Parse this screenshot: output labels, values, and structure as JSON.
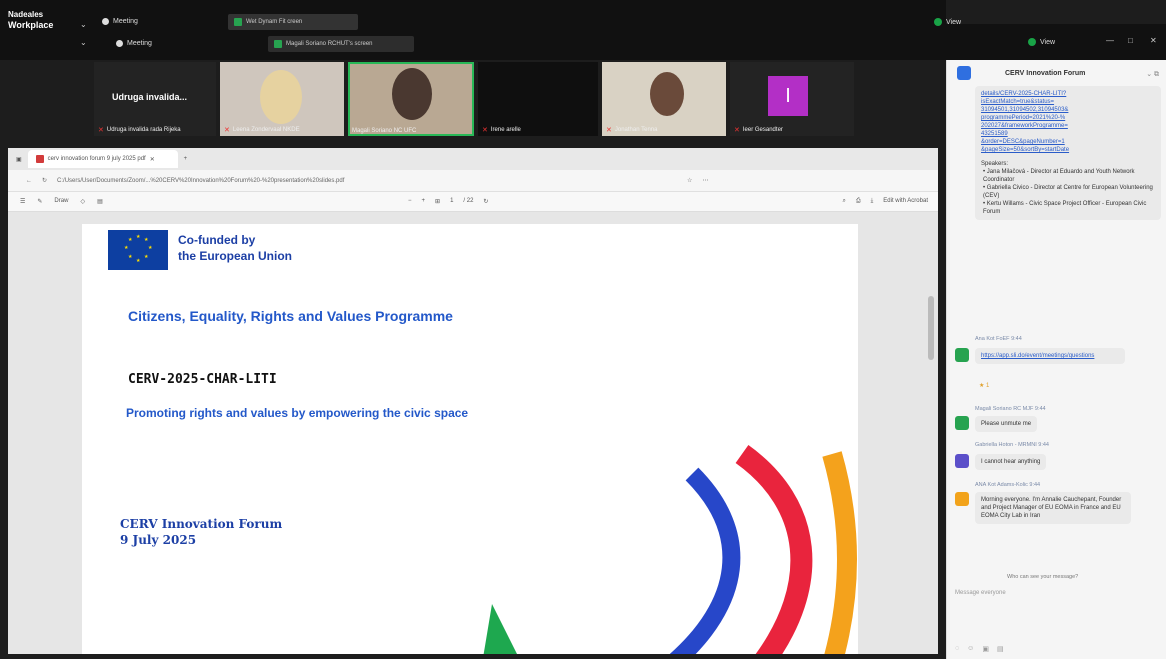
{
  "topbar": {
    "workspace_small": "Nadeales",
    "workspace_big": "Workplace",
    "item1": "Meeting",
    "item2": "Meeting",
    "tab1": "Wet Dynam Fit creen",
    "tab2": "Magali Soriano RCHUT's screen",
    "view_label": "View"
  },
  "gallery": {
    "tile1_big": "Udruga invalida...",
    "tile1_name": "Udruga invalida rada Rijeka",
    "tile2_name": "Leena Zondervaal NKDE",
    "tile3_name": "Magali Soriano NC UFC",
    "tile4_name": "Irene arelle",
    "tile5_name": "Jonathan Tenna",
    "tile6_name": "Ieer Gesandter",
    "tile6_initial": "I"
  },
  "browser": {
    "tab_label": "cerv innovation forum 9 july 2025 pdf",
    "url": "C:/Users/User/Documents/Zoom/...%20CERV%20Innovation%20Forum%20-%20presentation%20slides.pdf",
    "zoom": "118",
    "page_current": "1",
    "page_total": "/ 22",
    "edit_btn": "Edit with Acrobat",
    "draw_label": "Draw"
  },
  "slide": {
    "eu_line1": "Co-funded by",
    "eu_line2": "the European Union",
    "programme": "Citizens, Equality, Rights and Values Programme",
    "code": "CERV-2025-CHAR-LITI",
    "subtitle": "Promoting rights and values  by empowering the civic space",
    "forum_line1": "CERV Innovation Forum",
    "forum_line2": "9 July 2025"
  },
  "chat": {
    "title": "CERV Innovation Forum",
    "links": [
      "details/CERV-2025-CHAR-LITI?",
      "isExactMatch=true&status=",
      "31094501,31094502,31094503&",
      "programmePeriod=2021%20-%",
      "202027&frameworkProgramme=",
      "43251589",
      "&order=DESC&pageNumber=1",
      "&pageSize=50&sortBy=startDate"
    ],
    "speakers_label": "Speakers:",
    "speakers": [
      "Jana Milačová - Director at Eduardo and Youth Network Coordinator",
      "Gabriella Civico - Director at Centre for European Volunteering (CEV)",
      "Kertu Willams - Civic Space Project Officer - European Civic Forum"
    ],
    "msg2_user": "Ana Kot FoEF  9:44",
    "msg2_link": "https://app.sli.do/event/meetings/questions",
    "msg2_react": "1",
    "msg3_user": "Magali Soriano  RC MJF  9:44",
    "msg3_text": "Please unmute me",
    "msg4_user": "Gabriella Hoton - MRMNI  9:44",
    "msg4_text": "I cannot hear anything",
    "msg5_user": "ANA Kot Adams-Kolic  9:44",
    "msg5_text": "Morning everyone. I'm Annalie Cauchepant, Founder and Project Manager of EU EOMA in France and EU EOMA City Lab in Iran",
    "reply_hint": "Who can see your message?",
    "composer": "Message everyone"
  }
}
